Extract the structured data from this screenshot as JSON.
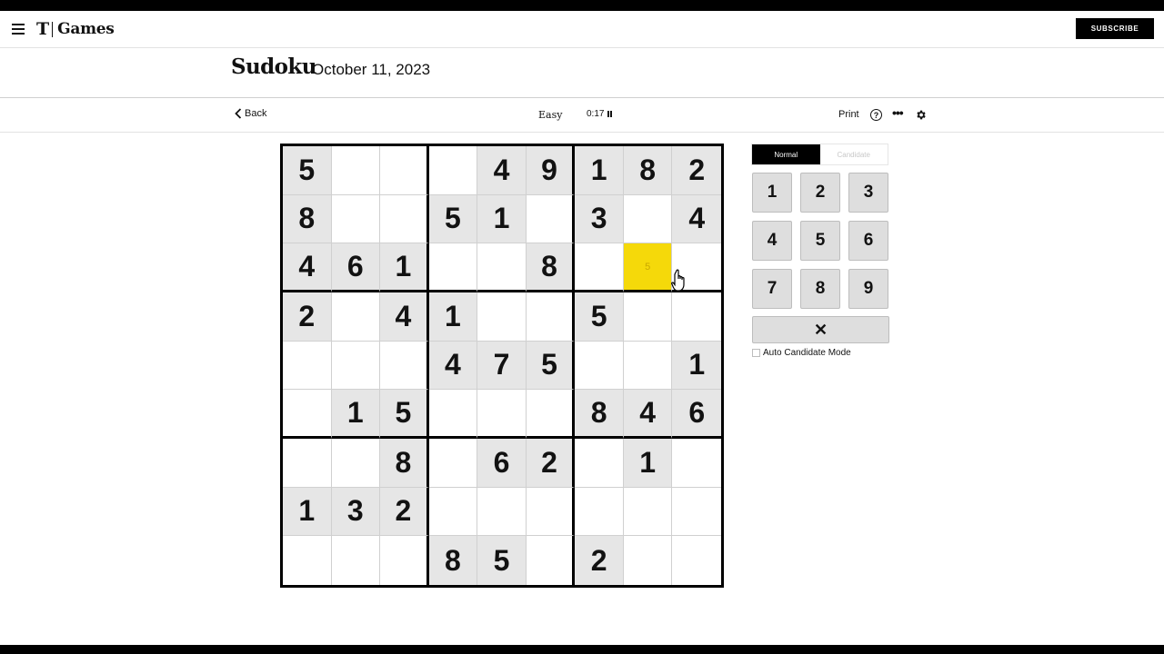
{
  "brand": {
    "t_logo": "T",
    "name": "Games"
  },
  "header": {
    "subscribe_label": "SUBSCRIBE"
  },
  "puzzle": {
    "title": "Sudoku",
    "date": "October 11, 2023"
  },
  "toolbar": {
    "back_label": "Back",
    "difficulty": "Easy",
    "timer": "0:17",
    "print_label": "Print",
    "help_label": "?",
    "more_label": "•••"
  },
  "grid": [
    [
      "5",
      "",
      "",
      "",
      "4",
      "9",
      "1",
      "8",
      "2"
    ],
    [
      "8",
      "",
      "",
      "5",
      "1",
      "",
      "3",
      "",
      "4"
    ],
    [
      "4",
      "6",
      "1",
      "",
      "",
      "8",
      "",
      "5",
      ""
    ],
    [
      "2",
      "",
      "4",
      "1",
      "",
      "",
      "5",
      "",
      ""
    ],
    [
      "",
      "",
      "",
      "4",
      "7",
      "5",
      "",
      "",
      "1"
    ],
    [
      "",
      "1",
      "5",
      "",
      "",
      "",
      "8",
      "4",
      "6"
    ],
    [
      "",
      "",
      "8",
      "",
      "6",
      "2",
      "",
      "1",
      ""
    ],
    [
      "1",
      "3",
      "2",
      "",
      "",
      "",
      "",
      "",
      ""
    ],
    [
      "",
      "",
      "",
      "8",
      "5",
      "",
      "2",
      "",
      ""
    ]
  ],
  "selected_cell": {
    "row": 2,
    "col": 7,
    "pencil_value": "5"
  },
  "modes": {
    "normal": "Normal",
    "candidate": "Candidate",
    "active": "normal"
  },
  "keypad": [
    "1",
    "2",
    "3",
    "4",
    "5",
    "6",
    "7",
    "8",
    "9"
  ],
  "erase_label": "✕",
  "auto_candidate_label": "Auto Candidate Mode",
  "colors": {
    "selected": "#f5d90a",
    "given_bg": "#e6e6e6",
    "accent": "#000000"
  }
}
